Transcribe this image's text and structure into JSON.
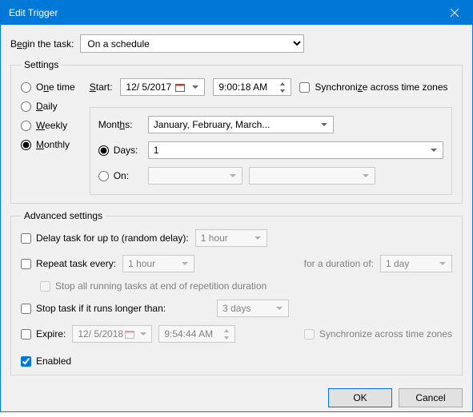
{
  "titlebar": {
    "title": "Edit Trigger"
  },
  "begin": {
    "label_pre": "B",
    "label_u": "e",
    "label_post": "gin the task:",
    "value": "On a schedule"
  },
  "settings": {
    "legend": "Settings",
    "one_time": {
      "pre": "O",
      "u": "n",
      "post": "e time"
    },
    "daily": {
      "u": "D",
      "post": "aily"
    },
    "weekly": {
      "u": "W",
      "post": "eekly"
    },
    "monthly": {
      "u": "M",
      "post": "onthly"
    },
    "start_u": "S",
    "start_post": "tart:",
    "start_date": "12/ 5/2017",
    "start_time": "9:00:18 AM",
    "sync_label": "Synchroni",
    "sync_u": "z",
    "sync_post": "e across time zones",
    "months_pre": "Mont",
    "months_u": "h",
    "months_post": "s:",
    "months_value": "January, February, March...",
    "days_label": "Days:",
    "days_value": "1",
    "on_label": "On:"
  },
  "advanced": {
    "legend": "Advanced settings",
    "delay_label": "Delay task for up to (random delay):",
    "delay_value": "1 hour",
    "repeat_label": "Repeat task every:",
    "repeat_value": "1 hour",
    "duration_label": "for a duration of:",
    "duration_value": "1 day",
    "stop_all_label": "Stop all running tasks at end of repetition duration",
    "stop_if_label": "Stop task if it runs longer than:",
    "stop_if_value": "3 days",
    "expire_label": "Expire:",
    "expire_date": "12/ 5/2018",
    "expire_time": "9:54:44 AM",
    "sync2_label": "Synchronize across time zones",
    "enabled_label": "Enabled"
  },
  "footer": {
    "ok": "OK",
    "cancel": "Cancel"
  }
}
